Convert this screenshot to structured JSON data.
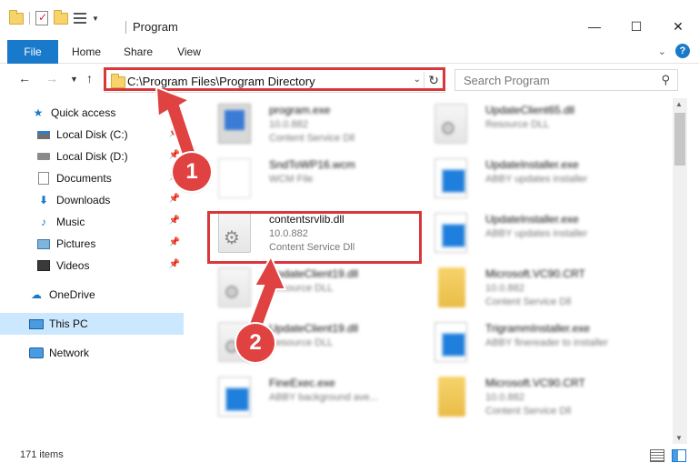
{
  "window": {
    "title": "Program",
    "min_icon": "minimize-icon",
    "max_icon": "maximize-icon",
    "close_icon": "close-icon"
  },
  "ribbon": {
    "tabs": [
      "File",
      "Home",
      "Share",
      "View"
    ],
    "file_tab_color": "#1979ca"
  },
  "nav": {
    "address": "C:\\Program Files\\Program Directory",
    "search_placeholder": "Search Program"
  },
  "sidebar": {
    "items": [
      {
        "label": "Quick access",
        "icon": "star-icon"
      },
      {
        "label": "Local Disk (C:)",
        "icon": "drive-icon"
      },
      {
        "label": "Local Disk (D:)",
        "icon": "drive-icon"
      },
      {
        "label": "Documents",
        "icon": "documents-icon"
      },
      {
        "label": "Downloads",
        "icon": "downloads-icon"
      },
      {
        "label": "Music",
        "icon": "music-icon"
      },
      {
        "label": "Pictures",
        "icon": "pictures-icon"
      },
      {
        "label": "Videos",
        "icon": "videos-icon"
      },
      {
        "label": "OneDrive",
        "icon": "cloud-icon"
      },
      {
        "label": "This PC",
        "icon": "computer-icon"
      },
      {
        "label": "Network",
        "icon": "network-icon"
      }
    ]
  },
  "files": [
    {
      "name": "program.exe",
      "line2": "10.0.882",
      "line3": "Content Service Dll"
    },
    {
      "name": "UpdateClient65.dll",
      "line2": "Resource DLL",
      "line3": ""
    },
    {
      "name": "SndToWP16.wcm",
      "line2": "WCM File",
      "line3": ""
    },
    {
      "name": "UpdateInstaller.exe",
      "line2": "ABBY updates installer",
      "line3": ""
    },
    {
      "name": "contentsrvlib.dll",
      "line2": "10.0.882",
      "line3": "Content Service Dll"
    },
    {
      "name": "UpdateInstaller.exe",
      "line2": "ABBY updates installer",
      "line3": ""
    },
    {
      "name": "UpdateClient19.dll",
      "line2": "Resource DLL",
      "line3": ""
    },
    {
      "name": "Microsoft.VC90.CRT",
      "line2": "10.0.882",
      "line3": "Content Service Dll"
    },
    {
      "name": "UpdateClient19.dll",
      "line2": "Resource DLL",
      "line3": ""
    },
    {
      "name": "TrigrammInstaller.exe",
      "line2": "ABBY finereader to installer",
      "line3": ""
    },
    {
      "name": "FineExec.exe",
      "line2": "ABBY background ave...",
      "line3": ""
    },
    {
      "name": "Microsoft.VC90.CRT",
      "line2": "10.0.882",
      "line3": "Content Service Dll"
    }
  ],
  "status": {
    "count": "171 items"
  },
  "annotations": {
    "badge1": "1",
    "badge2": "2",
    "highlight_color": "#d9383a"
  }
}
